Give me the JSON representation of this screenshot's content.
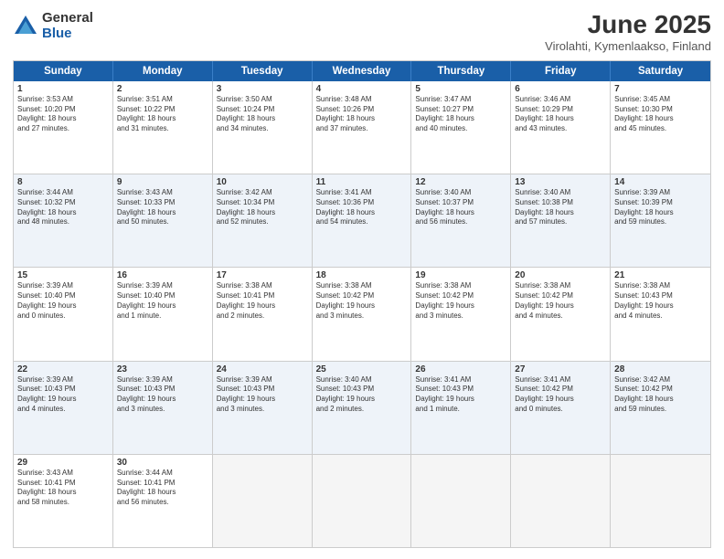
{
  "logo": {
    "general": "General",
    "blue": "Blue"
  },
  "header": {
    "title": "June 2025",
    "location": "Virolahti, Kymenlaakso, Finland"
  },
  "days": [
    "Sunday",
    "Monday",
    "Tuesday",
    "Wednesday",
    "Thursday",
    "Friday",
    "Saturday"
  ],
  "rows": [
    {
      "alt": false,
      "cells": [
        {
          "day": "1",
          "text": "Sunrise: 3:53 AM\nSunset: 10:20 PM\nDaylight: 18 hours\nand 27 minutes."
        },
        {
          "day": "2",
          "text": "Sunrise: 3:51 AM\nSunset: 10:22 PM\nDaylight: 18 hours\nand 31 minutes."
        },
        {
          "day": "3",
          "text": "Sunrise: 3:50 AM\nSunset: 10:24 PM\nDaylight: 18 hours\nand 34 minutes."
        },
        {
          "day": "4",
          "text": "Sunrise: 3:48 AM\nSunset: 10:26 PM\nDaylight: 18 hours\nand 37 minutes."
        },
        {
          "day": "5",
          "text": "Sunrise: 3:47 AM\nSunset: 10:27 PM\nDaylight: 18 hours\nand 40 minutes."
        },
        {
          "day": "6",
          "text": "Sunrise: 3:46 AM\nSunset: 10:29 PM\nDaylight: 18 hours\nand 43 minutes."
        },
        {
          "day": "7",
          "text": "Sunrise: 3:45 AM\nSunset: 10:30 PM\nDaylight: 18 hours\nand 45 minutes."
        }
      ]
    },
    {
      "alt": true,
      "cells": [
        {
          "day": "8",
          "text": "Sunrise: 3:44 AM\nSunset: 10:32 PM\nDaylight: 18 hours\nand 48 minutes."
        },
        {
          "day": "9",
          "text": "Sunrise: 3:43 AM\nSunset: 10:33 PM\nDaylight: 18 hours\nand 50 minutes."
        },
        {
          "day": "10",
          "text": "Sunrise: 3:42 AM\nSunset: 10:34 PM\nDaylight: 18 hours\nand 52 minutes."
        },
        {
          "day": "11",
          "text": "Sunrise: 3:41 AM\nSunset: 10:36 PM\nDaylight: 18 hours\nand 54 minutes."
        },
        {
          "day": "12",
          "text": "Sunrise: 3:40 AM\nSunset: 10:37 PM\nDaylight: 18 hours\nand 56 minutes."
        },
        {
          "day": "13",
          "text": "Sunrise: 3:40 AM\nSunset: 10:38 PM\nDaylight: 18 hours\nand 57 minutes."
        },
        {
          "day": "14",
          "text": "Sunrise: 3:39 AM\nSunset: 10:39 PM\nDaylight: 18 hours\nand 59 minutes."
        }
      ]
    },
    {
      "alt": false,
      "cells": [
        {
          "day": "15",
          "text": "Sunrise: 3:39 AM\nSunset: 10:40 PM\nDaylight: 19 hours\nand 0 minutes."
        },
        {
          "day": "16",
          "text": "Sunrise: 3:39 AM\nSunset: 10:40 PM\nDaylight: 19 hours\nand 1 minute."
        },
        {
          "day": "17",
          "text": "Sunrise: 3:38 AM\nSunset: 10:41 PM\nDaylight: 19 hours\nand 2 minutes."
        },
        {
          "day": "18",
          "text": "Sunrise: 3:38 AM\nSunset: 10:42 PM\nDaylight: 19 hours\nand 3 minutes."
        },
        {
          "day": "19",
          "text": "Sunrise: 3:38 AM\nSunset: 10:42 PM\nDaylight: 19 hours\nand 3 minutes."
        },
        {
          "day": "20",
          "text": "Sunrise: 3:38 AM\nSunset: 10:42 PM\nDaylight: 19 hours\nand 4 minutes."
        },
        {
          "day": "21",
          "text": "Sunrise: 3:38 AM\nSunset: 10:43 PM\nDaylight: 19 hours\nand 4 minutes."
        }
      ]
    },
    {
      "alt": true,
      "cells": [
        {
          "day": "22",
          "text": "Sunrise: 3:39 AM\nSunset: 10:43 PM\nDaylight: 19 hours\nand 4 minutes."
        },
        {
          "day": "23",
          "text": "Sunrise: 3:39 AM\nSunset: 10:43 PM\nDaylight: 19 hours\nand 3 minutes."
        },
        {
          "day": "24",
          "text": "Sunrise: 3:39 AM\nSunset: 10:43 PM\nDaylight: 19 hours\nand 3 minutes."
        },
        {
          "day": "25",
          "text": "Sunrise: 3:40 AM\nSunset: 10:43 PM\nDaylight: 19 hours\nand 2 minutes."
        },
        {
          "day": "26",
          "text": "Sunrise: 3:41 AM\nSunset: 10:43 PM\nDaylight: 19 hours\nand 1 minute."
        },
        {
          "day": "27",
          "text": "Sunrise: 3:41 AM\nSunset: 10:42 PM\nDaylight: 19 hours\nand 0 minutes."
        },
        {
          "day": "28",
          "text": "Sunrise: 3:42 AM\nSunset: 10:42 PM\nDaylight: 18 hours\nand 59 minutes."
        }
      ]
    },
    {
      "alt": false,
      "cells": [
        {
          "day": "29",
          "text": "Sunrise: 3:43 AM\nSunset: 10:41 PM\nDaylight: 18 hours\nand 58 minutes."
        },
        {
          "day": "30",
          "text": "Sunrise: 3:44 AM\nSunset: 10:41 PM\nDaylight: 18 hours\nand 56 minutes."
        },
        {
          "day": "",
          "text": ""
        },
        {
          "day": "",
          "text": ""
        },
        {
          "day": "",
          "text": ""
        },
        {
          "day": "",
          "text": ""
        },
        {
          "day": "",
          "text": ""
        }
      ]
    }
  ]
}
